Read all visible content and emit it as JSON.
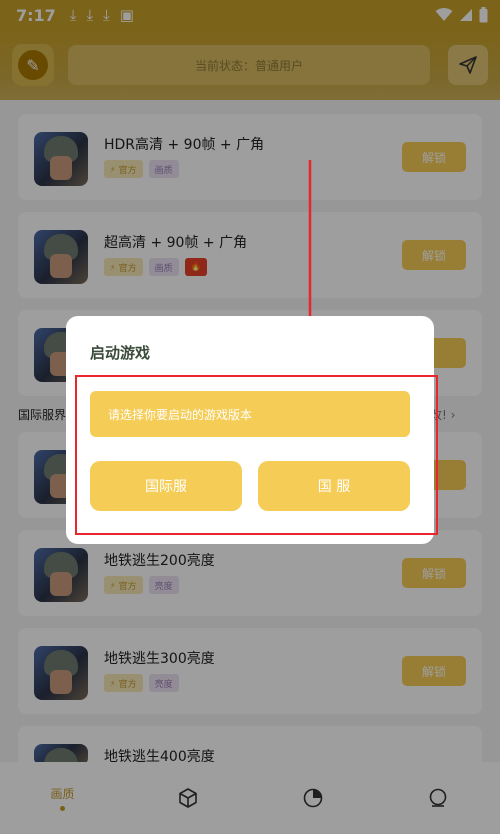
{
  "status_bar": {
    "time": "7:17"
  },
  "header": {
    "status_text": "当前状态：普通用户"
  },
  "items": [
    {
      "title": "HDR高清 + 90帧 + 广角",
      "tag_official": "官方",
      "tag_quality": "画质",
      "has_fire": false,
      "button": "解锁"
    },
    {
      "title": "超高清 + 90帧 + 广角",
      "tag_official": "官方",
      "tag_quality": "画质",
      "has_fire": true,
      "button": "解锁"
    },
    {
      "title": "",
      "tag_official": "",
      "tag_quality": "",
      "has_fire": false,
      "button": ""
    },
    {
      "title": "",
      "tag_official": "",
      "tag_quality": "",
      "has_fire": false,
      "button": ""
    },
    {
      "title": "地铁逃生200亮度",
      "tag_official": "官方",
      "tag_quality": "亮度",
      "has_fire": false,
      "button": "解锁"
    },
    {
      "title": "地铁逃生300亮度",
      "tag_official": "官方",
      "tag_quality": "亮度",
      "has_fire": false,
      "button": "解锁"
    },
    {
      "title": "地铁逃生400亮度",
      "tag_official": "",
      "tag_quality": "",
      "has_fire": false,
      "button": ""
    }
  ],
  "section": {
    "title": "国际服界",
    "more": "改!"
  },
  "dialog": {
    "title": "启动游戏",
    "prompt": "请选择你要启动的游戏版本",
    "option_intl": "国际服",
    "option_cn": "国 服"
  },
  "bottom_nav": {
    "home_label": "画质"
  },
  "colors": {
    "accent": "#f5cc56",
    "annotation": "#e8262b"
  }
}
